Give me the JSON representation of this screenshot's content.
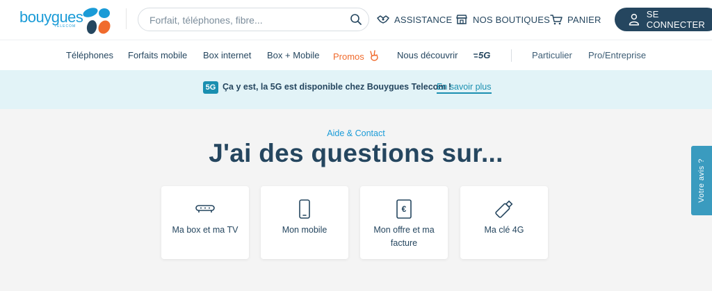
{
  "logo": {
    "brand": "bouygues",
    "sub": "TELECOM",
    "colors": [
      "#1a9bd7",
      "#25465f",
      "#f06b2d"
    ]
  },
  "search": {
    "placeholder": "Forfait, téléphones, fibre..."
  },
  "header_links": {
    "assistance": "ASSISTANCE",
    "boutiques": "NOS BOUTIQUES",
    "panier": "PANIER",
    "connect": "SE CONNECTER"
  },
  "nav": {
    "items": [
      "Téléphones",
      "Forfaits mobile",
      "Box internet",
      "Box + Mobile",
      "Promos",
      "Nous découvrir",
      "5G"
    ],
    "segments": [
      "Particulier",
      "Pro/Entreprise"
    ]
  },
  "banner": {
    "badge": "5G",
    "text": "Ça y est, la 5G est disponible chez Bouygues Telecom !",
    "link": "En savoir plus"
  },
  "main": {
    "kicker": "Aide & Contact",
    "title": "J'ai des questions sur...",
    "cards": [
      {
        "label": "Ma box et ma TV",
        "icon": "box-tv-icon"
      },
      {
        "label": "Mon mobile",
        "icon": "mobile-icon"
      },
      {
        "label": "Mon offre et ma facture",
        "icon": "invoice-icon"
      },
      {
        "label": "Ma clé 4G",
        "icon": "usb-key-icon"
      }
    ]
  },
  "side_tab": {
    "label": "Votre avis ?"
  },
  "colors": {
    "primary": "#25465f",
    "accent": "#1a9bd7",
    "promo": "#f06b2d",
    "banner_bg": "#e2f3f7",
    "page_bg": "#f4f4f4"
  }
}
